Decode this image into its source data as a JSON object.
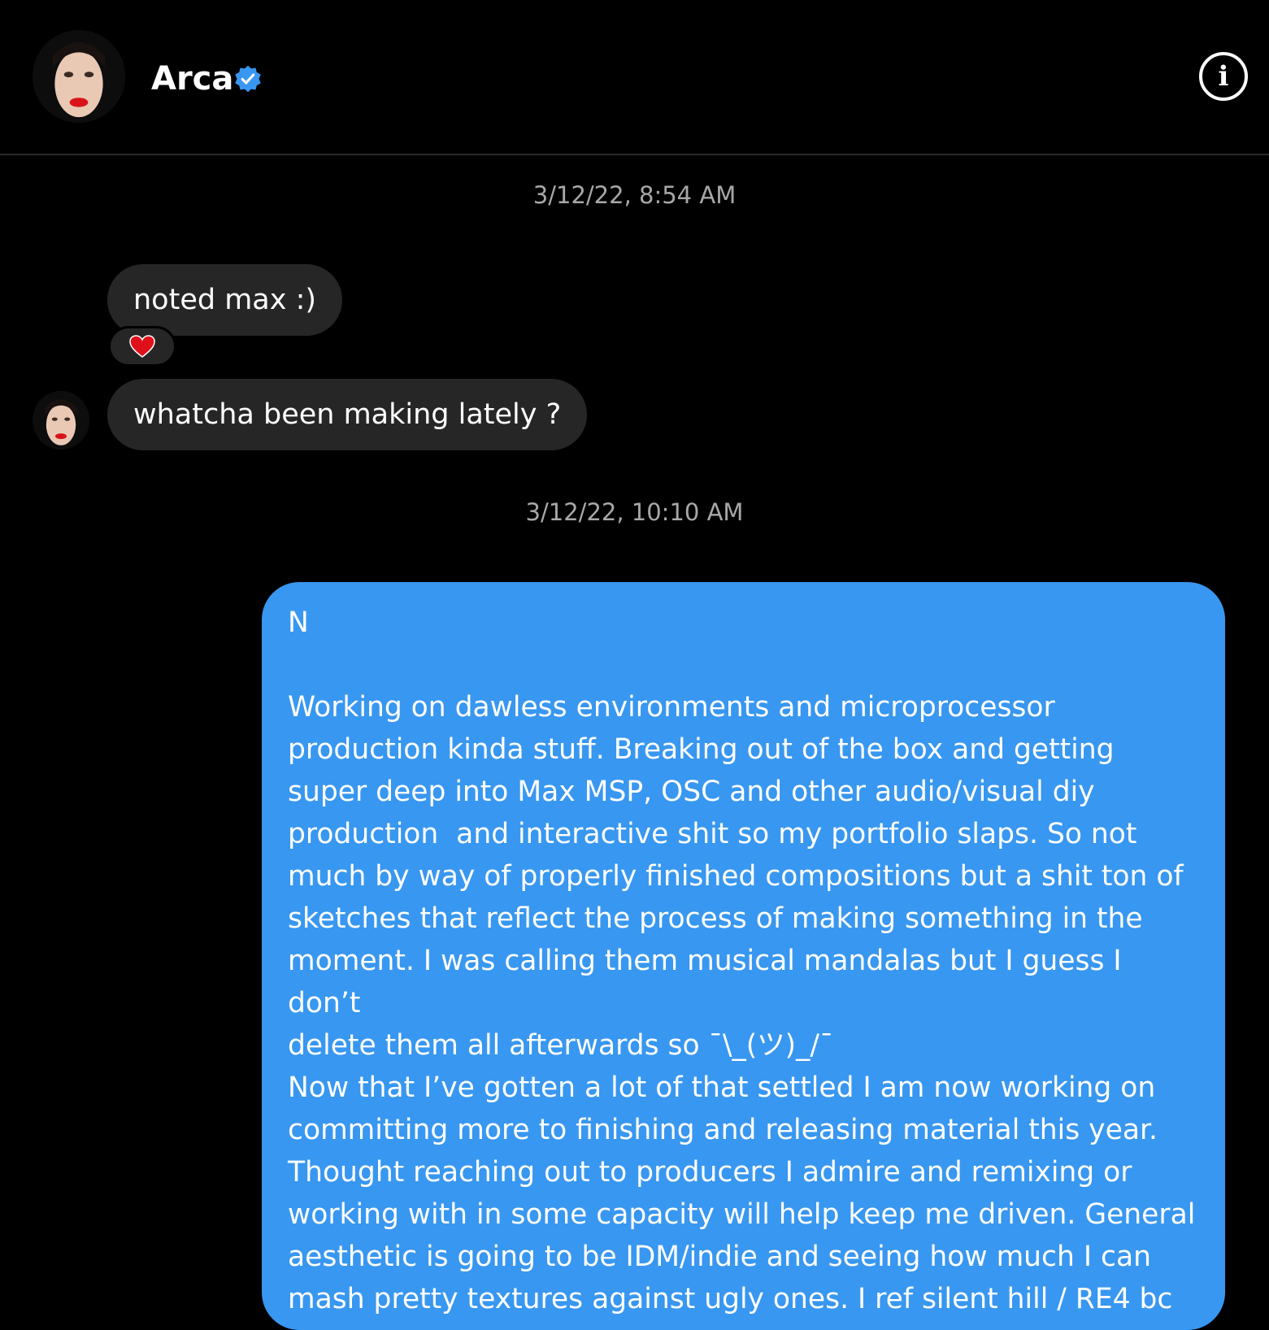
{
  "header": {
    "contact_name": "Arca",
    "avatar_icon": "profile-photo",
    "verified_icon": "verified-badge-icon",
    "info_label": "i"
  },
  "conversation": {
    "timestamp_1": "3/12/22, 8:54 AM",
    "message_1": "noted max :)",
    "message_1_reaction": "heart",
    "message_2": "whatcha been making lately ?",
    "timestamp_2": "3/12/22, 10:10 AM",
    "message_3": "N\n\nWorking on dawless environments and microprocessor\nproduction kinda stuff. Breaking out of the box and getting\nsuper deep into Max MSP, OSC and other audio/visual diy\nproduction  and interactive shit so my portfolio slaps. So not\nmuch by way of properly finished compositions but a shit ton of\nsketches that reflect the process of making something in the\nmoment. I was calling them musical mandalas but I guess I don’t\ndelete them all afterwards so ¯\\_(ツ)_/¯\nNow that I’ve gotten a lot of that settled I am now working on\ncommitting more to finishing and releasing material this year.\nThought reaching out to producers I admire and remixing or\nworking with in some capacity will help keep me driven. General\naesthetic is going to be IDM/indie and seeing how much I can\nmash pretty textures against ugly ones. I ref silent hill / RE4 bc"
  },
  "colors": {
    "background": "#000000",
    "incoming_bubble": "#262626",
    "outgoing_bubble": "#3897f0",
    "verified": "#3897f0",
    "timestamp": "#a8a8a8"
  }
}
